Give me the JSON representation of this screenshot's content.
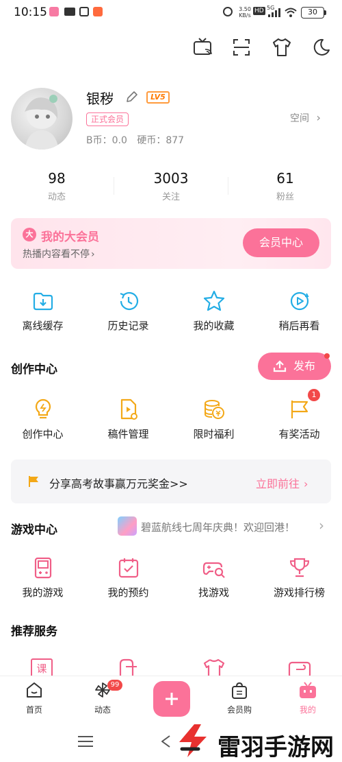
{
  "status_bar": {
    "time": "10:15",
    "net_speed": "3.50\nKB/s",
    "hd": "HD",
    "signal": "5G",
    "battery": "30"
  },
  "profile": {
    "username": "银秽",
    "level": "LV5",
    "vip_tag": "正式会员",
    "b_coin": "B币：0.0",
    "coin": "硬币：877",
    "space": "空间"
  },
  "stats": [
    {
      "value": "98",
      "label": "动态"
    },
    {
      "value": "3003",
      "label": "关注"
    },
    {
      "value": "61",
      "label": "粉丝"
    }
  ],
  "vip_card": {
    "title": "我的大会员",
    "subtitle": "热播内容看不停",
    "button": "会员中心",
    "badge": "大"
  },
  "quick_actions": [
    {
      "label": "离线缓存",
      "icon": "download-icon"
    },
    {
      "label": "历史记录",
      "icon": "history-icon"
    },
    {
      "label": "我的收藏",
      "icon": "star-icon"
    },
    {
      "label": "稍后再看",
      "icon": "watch-later-icon"
    }
  ],
  "creation": {
    "title": "创作中心",
    "publish_label": "发布",
    "items": [
      {
        "label": "创作中心",
        "icon": "lightbulb-icon"
      },
      {
        "label": "稿件管理",
        "icon": "manuscript-icon"
      },
      {
        "label": "限时福利",
        "icon": "coins-icon"
      },
      {
        "label": "有奖活动",
        "icon": "flag-icon",
        "badge": "1"
      }
    ]
  },
  "banner": {
    "text": "分享高考故事赢万元奖金>>",
    "action": "立即前往"
  },
  "game_center": {
    "title": "游戏中心",
    "promo": "碧蓝航线七周年庆典！欢迎回港！",
    "items": [
      {
        "label": "我的游戏",
        "icon": "gamepad-icon"
      },
      {
        "label": "我的预约",
        "icon": "calendar-check-icon"
      },
      {
        "label": "找游戏",
        "icon": "controller-search-icon"
      },
      {
        "label": "游戏排行榜",
        "icon": "trophy-icon"
      }
    ]
  },
  "recommended": {
    "title": "推荐服务",
    "items": [
      {
        "icon": "course-icon",
        "glyph": "课"
      },
      {
        "icon": "bag-icon"
      },
      {
        "icon": "tshirt-icon"
      },
      {
        "icon": "wallet-icon"
      }
    ]
  },
  "tab_bar": [
    {
      "label": "首页",
      "icon": "home-icon"
    },
    {
      "label": "动态",
      "icon": "pinwheel-icon",
      "badge": "99"
    },
    {
      "label": "",
      "icon": "plus-icon"
    },
    {
      "label": "会员购",
      "icon": "shopping-bag-icon"
    },
    {
      "label": "我的",
      "icon": "tv-icon",
      "active": true
    }
  ],
  "watermark": "雷羽手游网",
  "colors": {
    "accent": "#fb7299",
    "accent_light": "#ffe4ec",
    "text": "#222222",
    "muted": "#999999",
    "orange": "#ff9a3c"
  }
}
